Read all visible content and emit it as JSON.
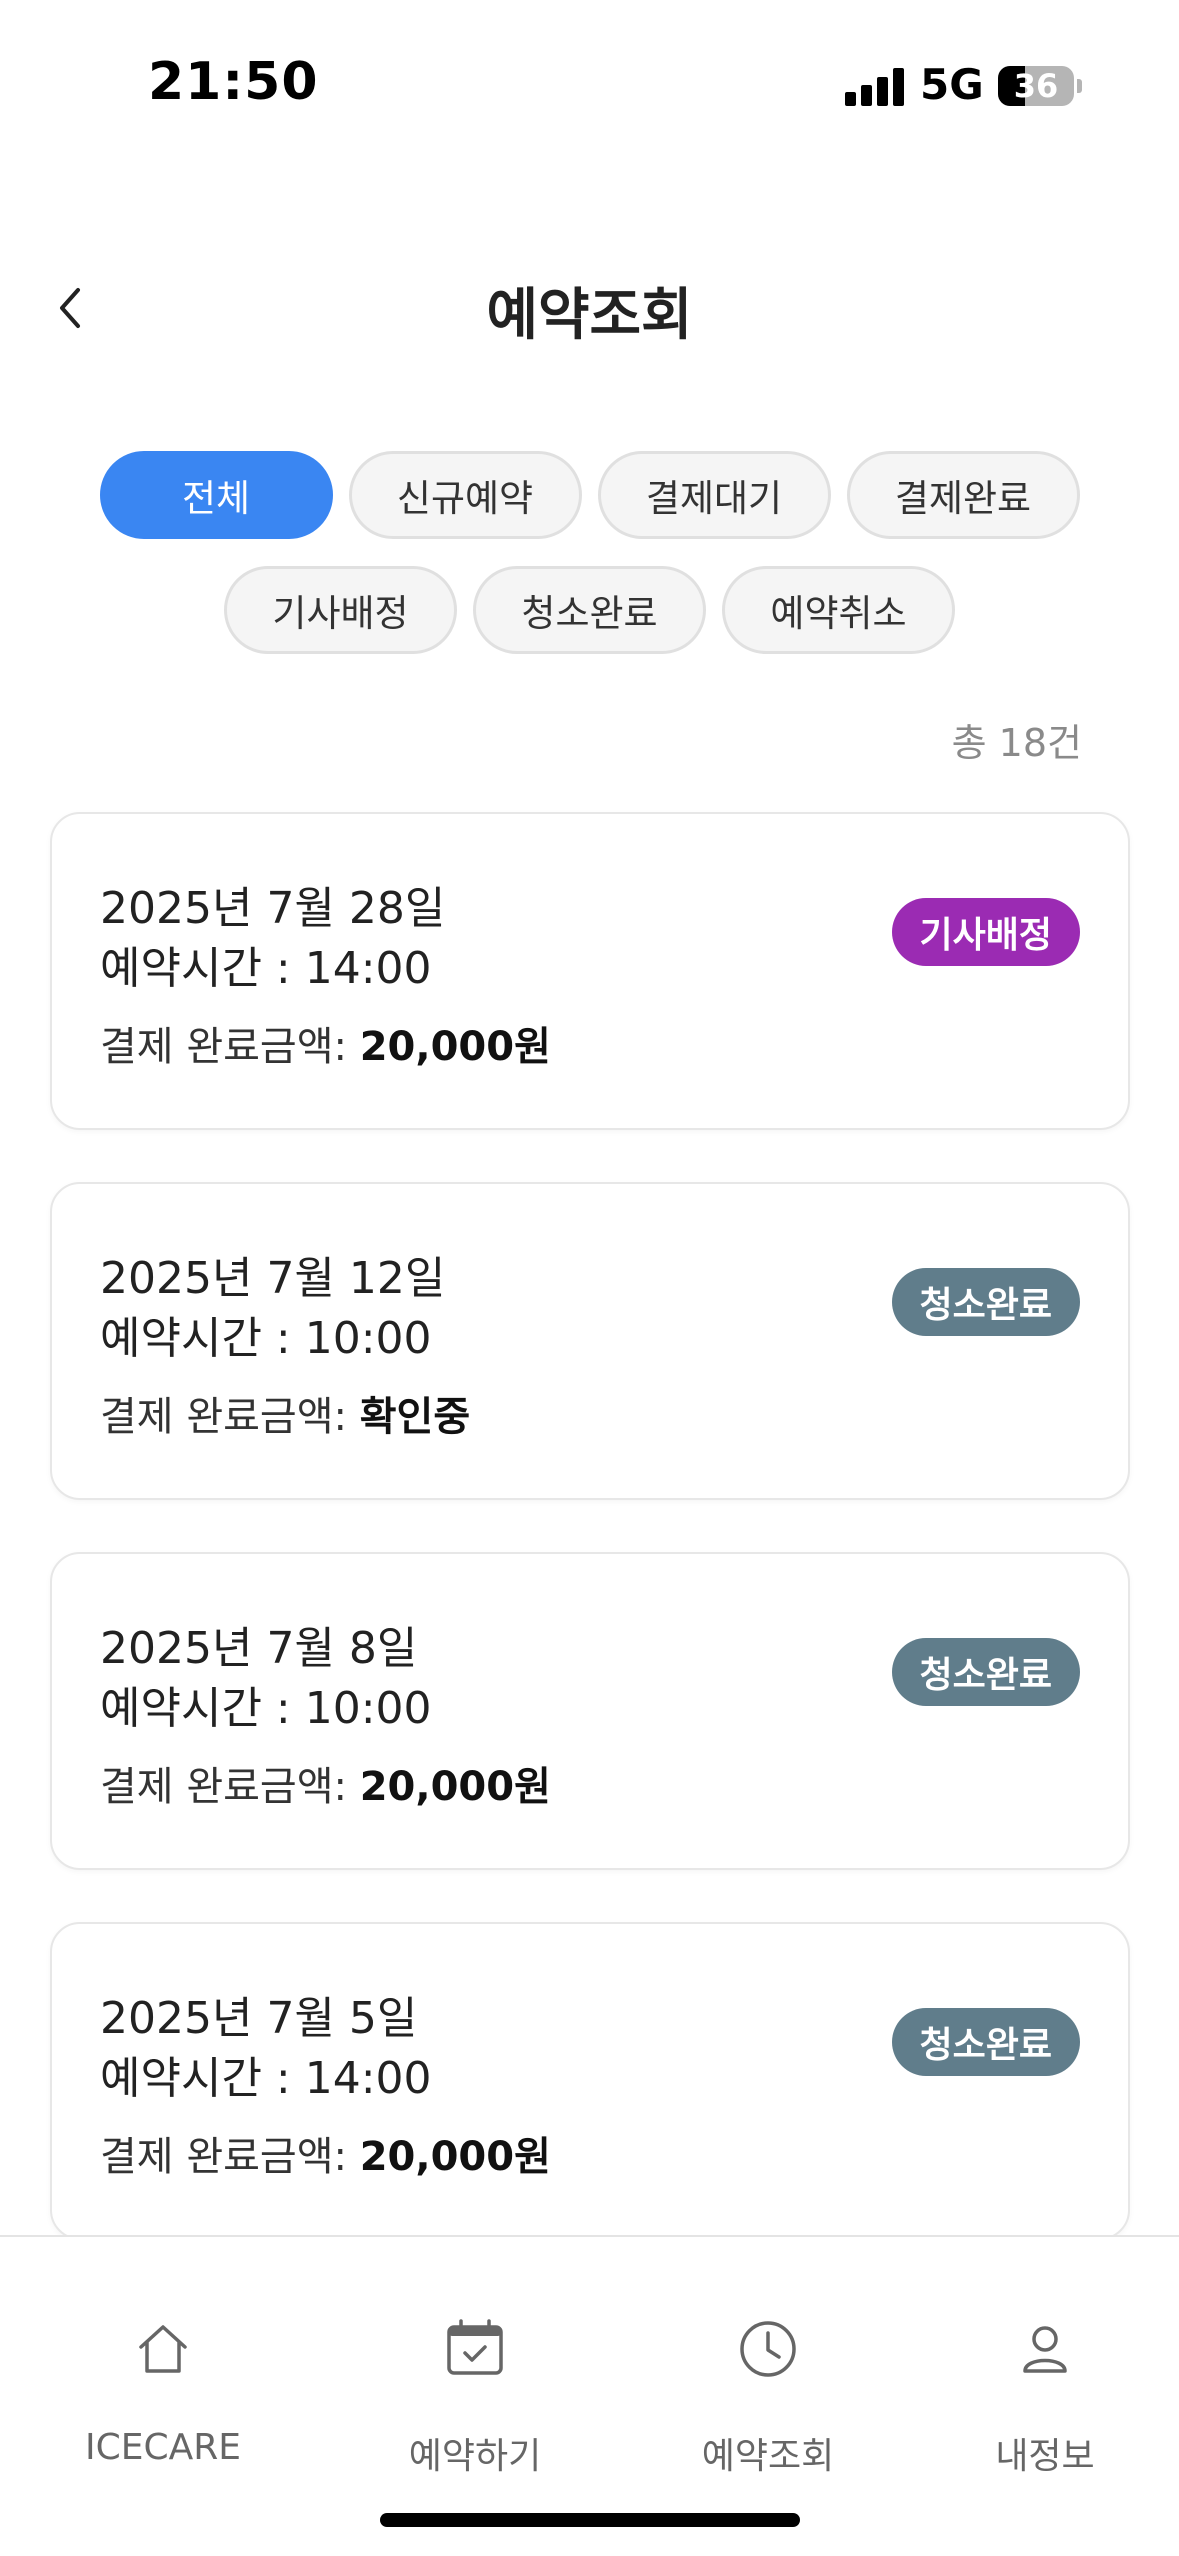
{
  "status_bar": {
    "time": "21:50",
    "network": "5G",
    "battery": "36",
    "battery_level_percent": 36
  },
  "header": {
    "title": "예약조회",
    "back_icon": "chevron-left-icon"
  },
  "filters": {
    "row1": [
      {
        "label": "전체",
        "active": true
      },
      {
        "label": "신규예약",
        "active": false
      },
      {
        "label": "결제대기",
        "active": false
      },
      {
        "label": "결제완료",
        "active": false
      }
    ],
    "row2": [
      {
        "label": "기사배정",
        "active": false
      },
      {
        "label": "청소완료",
        "active": false
      },
      {
        "label": "예약취소",
        "active": false
      }
    ],
    "active_color": "#3a86f2"
  },
  "total_count": "총 18건",
  "amount_label": "결제 완료금액: ",
  "reservations": [
    {
      "date": "2025년 7월 28일",
      "time": "예약시간 : 14:00",
      "amount": "20,000원",
      "status": "기사배정",
      "status_color": "#9b2bb3"
    },
    {
      "date": "2025년 7월 12일",
      "time": "예약시간 : 10:00",
      "amount": "확인중",
      "status": "청소완료",
      "status_color": "#607d8b"
    },
    {
      "date": "2025년 7월 8일",
      "time": "예약시간 : 10:00",
      "amount": "20,000원",
      "status": "청소완료",
      "status_color": "#607d8b"
    },
    {
      "date": "2025년 7월 5일",
      "time": "예약시간 : 14:00",
      "amount": "20,000원",
      "status": "청소완료",
      "status_color": "#607d8b"
    }
  ],
  "bottom_nav": [
    {
      "label": "ICECARE",
      "icon": "home-icon"
    },
    {
      "label": "예약하기",
      "icon": "calendar-check-icon"
    },
    {
      "label": "예약조회",
      "icon": "clock-icon"
    },
    {
      "label": "내정보",
      "icon": "user-icon"
    }
  ]
}
